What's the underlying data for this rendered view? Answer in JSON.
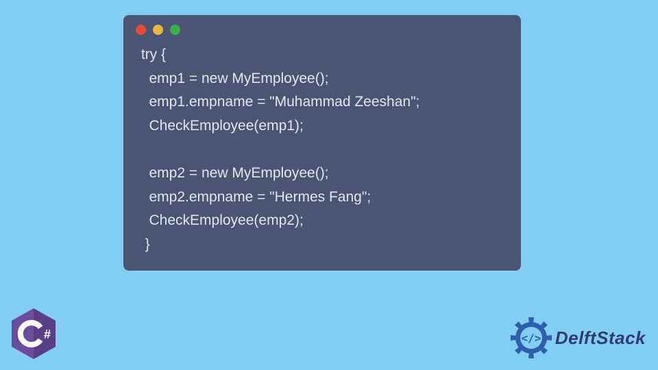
{
  "window": {
    "dots": [
      "red",
      "yellow",
      "green"
    ]
  },
  "code": {
    "lines": [
      " try {",
      "   emp1 = new MyEmployee();",
      "   emp1.empname = \"Muhammad Zeeshan\";",
      "   CheckEmployee(emp1);",
      "",
      "   emp2 = new MyEmployee();",
      "   emp2.empname = \"Hermes Fang\";",
      "   CheckEmployee(emp2);",
      "  }"
    ]
  },
  "branding": {
    "csharp_label": "C#",
    "delft_text": "DelftStack"
  },
  "colors": {
    "page_bg": "#82CEF2",
    "window_bg": "#4A5474",
    "code_text": "#E3E6EE",
    "csharp_purple": "#6A4C9C",
    "delft_blue": "#2D3E6B"
  }
}
